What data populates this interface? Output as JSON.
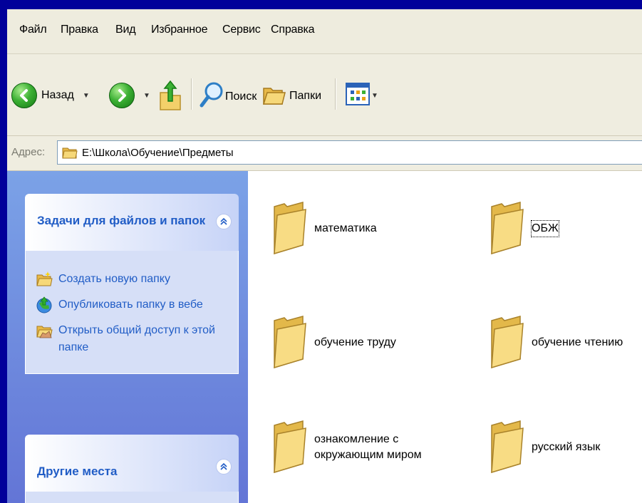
{
  "menu": {
    "items": [
      {
        "label": "Файл"
      },
      {
        "label": "Правка"
      },
      {
        "label": "Вид"
      },
      {
        "label": "Избранное"
      },
      {
        "label": "Сервис"
      },
      {
        "label": "Справка"
      }
    ]
  },
  "toolbar": {
    "back_label": "Назад",
    "search_label": "Поиск",
    "folders_label": "Папки"
  },
  "address": {
    "label": "Адрес:",
    "path": "E:\\Школа\\Обучение\\Предметы"
  },
  "tasks_panel": {
    "title": "Задачи для файлов и папок",
    "tasks": [
      {
        "label": "Создать новую папку",
        "icon": "new-folder-icon"
      },
      {
        "label": "Опубликовать папку в вебе",
        "icon": "publish-web-icon"
      },
      {
        "label": "Открыть общий доступ к этой папке",
        "icon": "share-folder-icon"
      }
    ]
  },
  "other_places_panel": {
    "title": "Другие места"
  },
  "folders": [
    {
      "name": "математика"
    },
    {
      "name": "ОБЖ",
      "selected": true
    },
    {
      "name": "обучение труду"
    },
    {
      "name": "обучение чтению"
    },
    {
      "name": "ознакомление с окружающим миром"
    },
    {
      "name": "русский язык"
    }
  ],
  "colors": {
    "background": "#01009a",
    "task_link": "#215dc6",
    "task_pane": "#7ba2e7"
  }
}
